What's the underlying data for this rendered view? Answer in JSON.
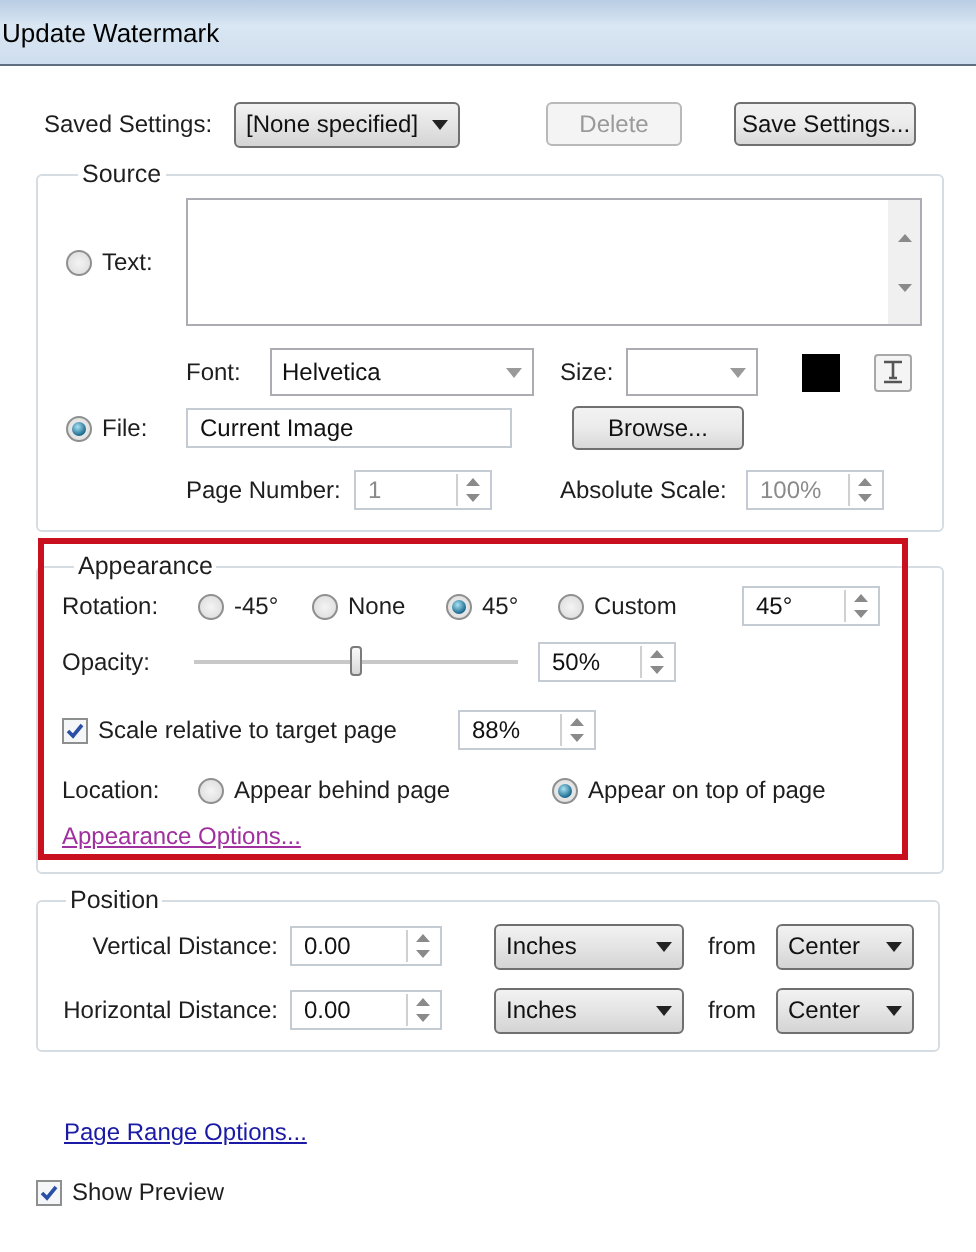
{
  "window": {
    "title": "Update Watermark"
  },
  "saved_settings": {
    "label": "Saved Settings:",
    "value": "[None specified]",
    "buttons": [
      {
        "label": "Delete",
        "disabled": true
      },
      {
        "label": "Save Settings...",
        "disabled": false
      }
    ]
  },
  "source": {
    "title": "Source",
    "text_option": {
      "label": "Text:",
      "selected": false
    },
    "font": {
      "label": "Font:",
      "value": "Helvetica"
    },
    "size": {
      "label": "Size:"
    },
    "file_option": {
      "label": "File:",
      "selected": true
    },
    "file": {
      "value": "Current Image",
      "button": "Browse..."
    },
    "page_number": {
      "label": "Page Number:",
      "value": "1",
      "disabled": true
    },
    "absolute_scale": {
      "label": "Absolute Scale:",
      "value": "100%",
      "disabled": true
    }
  },
  "appearance": {
    "title": "Appearance",
    "rotation": {
      "label": "Rotation:",
      "options": [
        {
          "label": "-45°",
          "selected": false
        },
        {
          "label": "None",
          "selected": false
        },
        {
          "label": "45°",
          "selected": true
        },
        {
          "label": "Custom",
          "selected": false
        }
      ],
      "value": "45°"
    },
    "opacity": {
      "label": "Opacity:",
      "level": 0.5,
      "value": "50%"
    },
    "scale": {
      "label": "Scale relative to target page",
      "checked": true,
      "value": "88%"
    },
    "location": {
      "label": "Location:",
      "options": [
        {
          "label": "Appear behind page",
          "selected": false
        },
        {
          "label": "Appear on top of page",
          "selected": true
        }
      ]
    },
    "options_link": {
      "text": "Appearance Options...",
      "visited": true
    }
  },
  "position": {
    "title": "Position",
    "rows": [
      {
        "label": "Vertical Distance:",
        "value": "0.00",
        "unit": "Inches",
        "from_label": "from",
        "anchor": "Center"
      },
      {
        "label": "Horizontal Distance:",
        "value": "0.00",
        "unit": "Inches",
        "from_label": "from",
        "anchor": "Center"
      }
    ]
  },
  "page_range_link": {
    "text": "Page Range Options...",
    "visited": false
  },
  "show_preview": {
    "label": "Show Preview",
    "checked": true
  }
}
